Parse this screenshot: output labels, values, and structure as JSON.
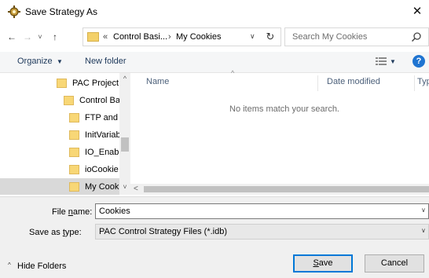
{
  "window": {
    "title": "Save Strategy As",
    "close_glyph": "✕"
  },
  "nav": {
    "back_glyph": "←",
    "forward_glyph": "→",
    "recent_glyph": "˅",
    "up_glyph": "↑",
    "breadcrumb_lead": "«",
    "breadcrumb": [
      "Control Basi...",
      "My Cookies"
    ],
    "breadcrumb_sep": "›",
    "dropdown_glyph": "∨",
    "refresh_glyph": "↻",
    "search_placeholder": "Search My Cookies"
  },
  "toolbar": {
    "organize_label": "Organize",
    "organize_caret": "▼",
    "new_folder_label": "New folder",
    "view_caret": "▼",
    "help_glyph": "?"
  },
  "tree": {
    "items": [
      {
        "label": "PAC Project"
      },
      {
        "label": "Control Ba"
      },
      {
        "label": "FTP and I"
      },
      {
        "label": "InitVariab"
      },
      {
        "label": "IO_Enabl"
      },
      {
        "label": "ioCookie"
      },
      {
        "label": "My Cook"
      }
    ],
    "selected_index": 6,
    "up_arrow": "^",
    "down_arrow": "˅"
  },
  "list": {
    "columns": [
      "Name",
      "Date modified",
      "Type"
    ],
    "sort_glyph": "^",
    "empty_message": "No items match your search.",
    "hscroll_left": "<"
  },
  "form": {
    "filename_label_pre": "File ",
    "filename_label_u": "n",
    "filename_label_post": "ame:",
    "filename_value": "Cookies",
    "savetype_label_pre": "Save as ",
    "savetype_label_u": "t",
    "savetype_label_post": "ype:",
    "savetype_value": "PAC Control Strategy Files (*.idb)",
    "caret": "∨"
  },
  "footer": {
    "hide_folders_caret": "^",
    "hide_folders_label": "Hide Folders",
    "save_u": "S",
    "save_rest": "ave",
    "cancel_label": "Cancel"
  },
  "colors": {
    "accent": "#0078d7",
    "folder": "#f8d776",
    "help": "#1f74d1",
    "selection": "#d9d9d9"
  }
}
